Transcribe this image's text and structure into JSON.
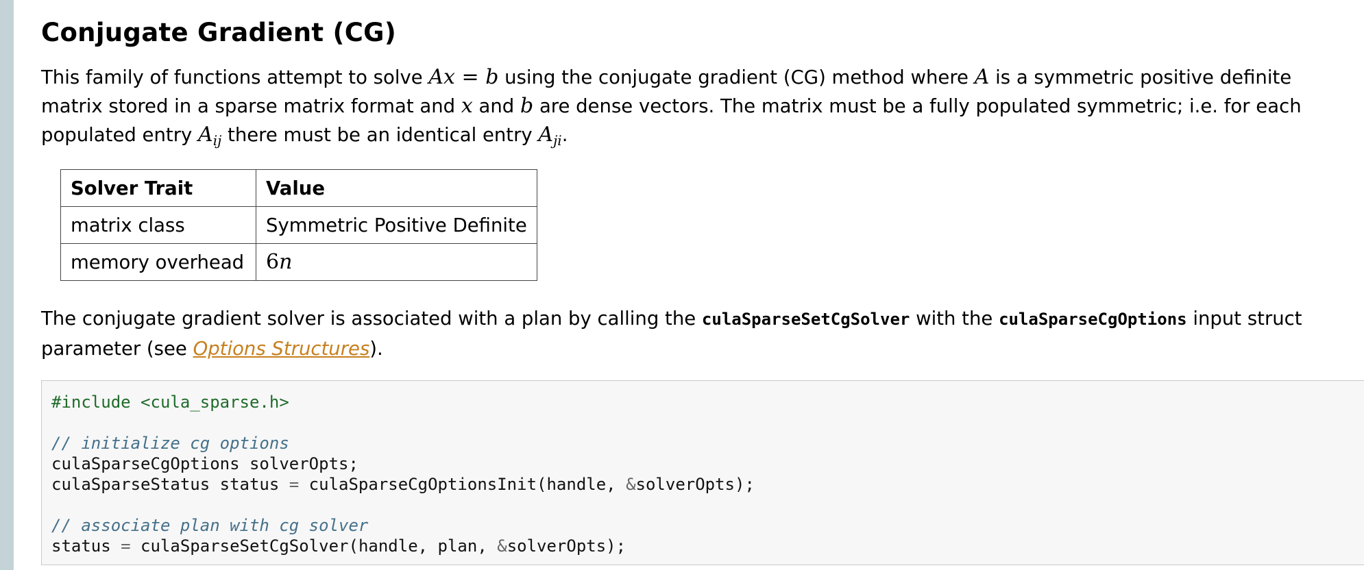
{
  "page": {
    "title": "Conjugate Gradient (CG)"
  },
  "para1": {
    "t1": "This family of functions attempt to solve ",
    "eq_lhs": "Ax",
    "eq_sign": " = ",
    "eq_rhs": "b",
    "t2": " using the conjugate gradient (CG) method where ",
    "var_a": "A",
    "t3": " is a symmetric positive definite matrix stored in a sparse matrix format and ",
    "var_x": "x",
    "t4": " and ",
    "var_b": "b",
    "t5": " are dense vectors. The matrix must be a fully populated symmetric; i.e. for each populated entry ",
    "aij_base": "A",
    "aij_sub": "ij",
    "t6": " there must be an identical entry ",
    "aji_base": "A",
    "aji_sub": "ji",
    "t7": "."
  },
  "table": {
    "headers": [
      "Solver Trait",
      "Value"
    ],
    "rows": [
      [
        "matrix class",
        "Symmetric Positive Definite"
      ],
      [
        "memory overhead",
        ""
      ]
    ],
    "overhead_num": "6",
    "overhead_var": "n"
  },
  "para2": {
    "t1": "The conjugate gradient solver is associated with a plan by calling the ",
    "fn1": "culaSparseSetCgSolver",
    "t2": " with the ",
    "fn2": "culaSparseCgOptions",
    "t3": " input struct parameter (see ",
    "link": "Options Structures",
    "t4": ")."
  },
  "code": {
    "line1": "#include <cula_sparse.h>",
    "comment1": "// initialize cg options",
    "line2": "culaSparseCgOptions solverOpts;",
    "line3a": "culaSparseStatus status ",
    "line3op": "=",
    "line3b": " culaSparseCgOptionsInit(handle, ",
    "line3amp": "&",
    "line3c": "solverOpts);",
    "comment2": "// associate plan with cg solver",
    "line4a": "status ",
    "line4op": "=",
    "line4b": " culaSparseSetCgSolver(handle, plan, ",
    "line4amp": "&",
    "line4c": "solverOpts);"
  }
}
